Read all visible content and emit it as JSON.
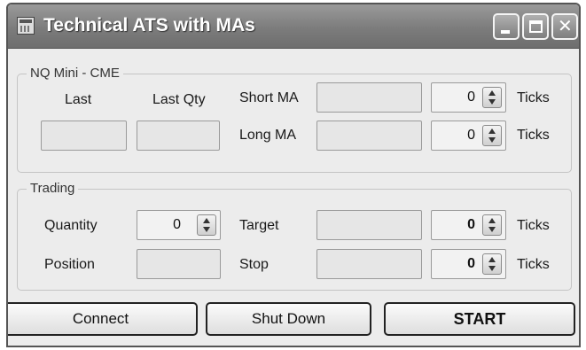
{
  "window": {
    "title": "Technical ATS with MAs",
    "controls": {
      "minimize_icon": "minimize-icon",
      "maximize_icon": "maximize-icon",
      "close_icon": "close-icon",
      "close_glyph": "✕"
    }
  },
  "market_group": {
    "legend": "NQ Mini - CME",
    "last_label": "Last",
    "last_qty_label": "Last Qty",
    "last_value": "",
    "last_qty_value": "",
    "short_ma_label": "Short MA",
    "short_ma_value": "",
    "short_ma_ticks": "0",
    "long_ma_label": "Long MA",
    "long_ma_value": "",
    "long_ma_ticks": "0",
    "ticks_label": "Ticks"
  },
  "trading_group": {
    "legend": "Trading",
    "quantity_label": "Quantity",
    "quantity_value": "0",
    "position_label": "Position",
    "position_value": "",
    "target_label": "Target",
    "target_value": "",
    "target_ticks": "0",
    "stop_label": "Stop",
    "stop_value": "",
    "stop_ticks": "0",
    "ticks_label": "Ticks"
  },
  "buttons": {
    "connect": "Connect",
    "shut_down": "Shut Down",
    "start": "START"
  }
}
